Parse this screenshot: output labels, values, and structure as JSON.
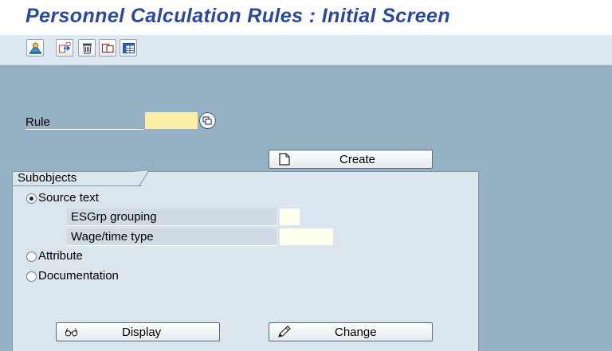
{
  "title": "Personnel Calculation Rules : Initial Screen",
  "toolbar": {
    "icons": [
      "where-used-list-icon",
      "copy-transfer-icon",
      "delete-trash-icon",
      "rename-copy-icon",
      "table-overview-icon"
    ]
  },
  "rule": {
    "label": "Rule",
    "value": ""
  },
  "buttons": {
    "create": "Create",
    "display": "Display",
    "change": "Change"
  },
  "subobjects": {
    "title": "Subobjects",
    "selected": "Source text",
    "options": {
      "source_text": "Source text",
      "attribute": "Attribute",
      "documentation": "Documentation"
    },
    "esgrp_label": "ESGrp grouping",
    "esgrp_value": "",
    "wagetype_label": "Wage/time type",
    "wagetype_value": ""
  },
  "colors": {
    "title": "#2a48a0",
    "workarea": "#97b1c4",
    "group_box": "#dae5ee",
    "required_field": "#fbefa5"
  }
}
